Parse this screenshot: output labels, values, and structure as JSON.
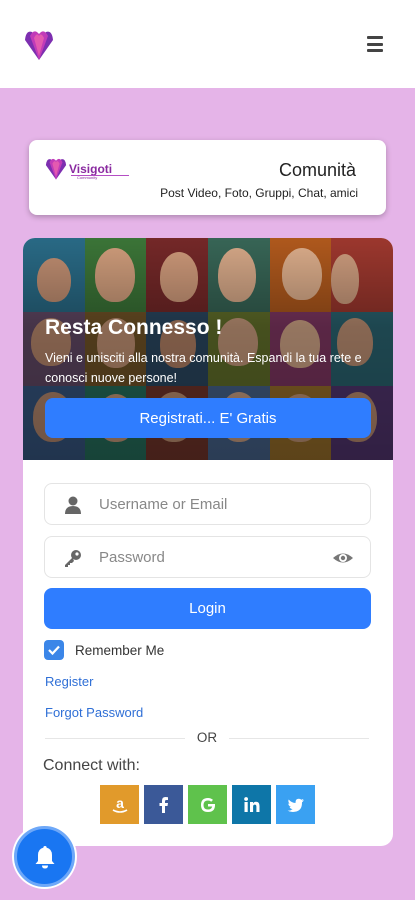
{
  "header": {
    "logo_icon": "lotus-logo-icon",
    "menu_icon": "hamburger-menu-icon"
  },
  "brand": {
    "logo_name": "Visigoti",
    "logo_tagline": "Community",
    "title": "Comunità",
    "subtitle": "Post Video, Foto, Gruppi, Chat, amici"
  },
  "hero": {
    "headline": "Resta Connesso !",
    "description": "Vieni e unisciti alla nostra comunità. Espandi la tua rete e conosci nuove persone!",
    "cta_label": "Registrati... E' Gratis"
  },
  "form": {
    "username_placeholder": "Username or Email",
    "password_placeholder": "Password",
    "login_label": "Login",
    "remember_label": "Remember Me",
    "remember_checked": true,
    "register_link": "Register",
    "forgot_link": "Forgot Password",
    "or_label": "OR",
    "connect_label": "Connect with:"
  },
  "socials": [
    {
      "name": "amazon",
      "glyph": "a",
      "color": "#e19a2b"
    },
    {
      "name": "facebook",
      "glyph": "f",
      "color": "#3b5998"
    },
    {
      "name": "google",
      "glyph": "G",
      "color": "#5fc24c"
    },
    {
      "name": "linkedin",
      "glyph": "in",
      "color": "#0e76a8"
    },
    {
      "name": "twitter",
      "glyph": "t",
      "color": "#3aa1f2"
    }
  ],
  "colors": {
    "background": "#e5b4e8",
    "primary": "#2f7dff",
    "link": "#2f6fd6",
    "brand": "#8a2aa0"
  }
}
